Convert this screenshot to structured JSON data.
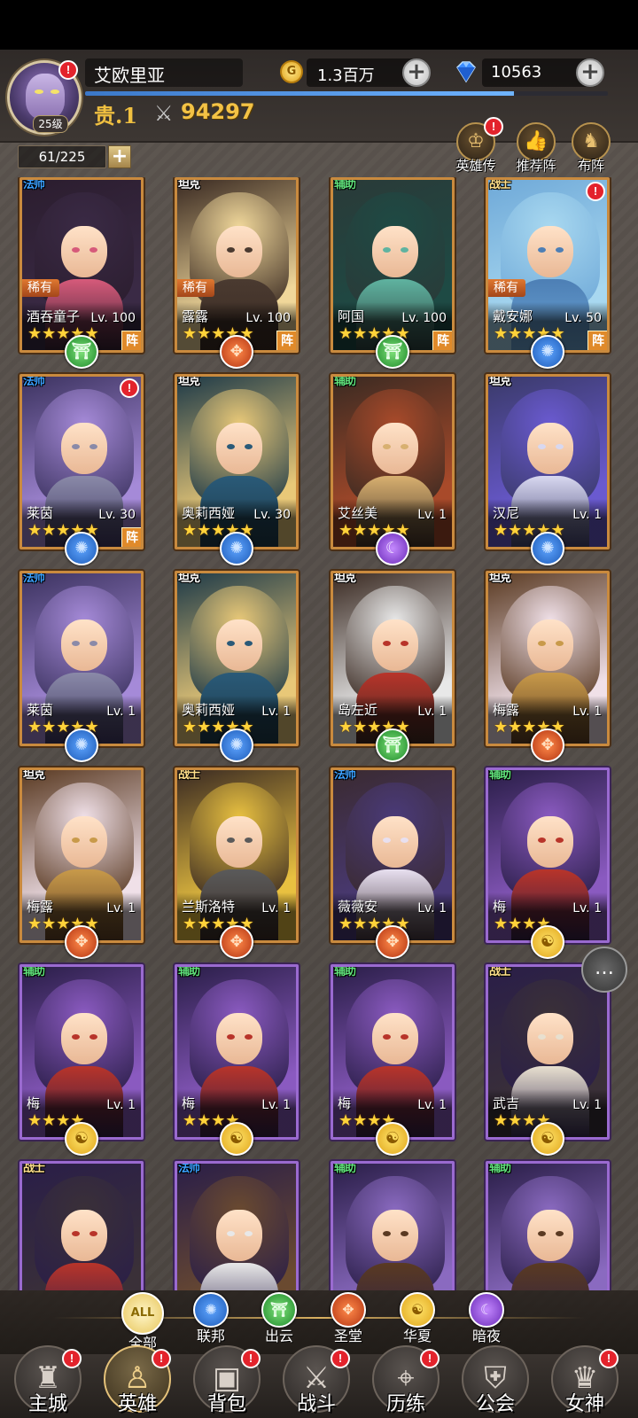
{
  "player": {
    "name": "艾欧里亚",
    "level_label": "25级",
    "vip_label": "贵.1",
    "power": "94297",
    "xp_progress": 0.82
  },
  "currency": {
    "gold": "1.3百万",
    "gold_icon": "G",
    "gems": "10563"
  },
  "hero_count": "61/225",
  "top_buttons": [
    {
      "label": "英雄传",
      "icon": "crown-icon",
      "alert": true
    },
    {
      "label": "推荐阵",
      "icon": "thumbs-up-icon",
      "alert": false
    },
    {
      "label": "布阵",
      "icon": "chess-knight-icon",
      "alert": false
    }
  ],
  "badge_text": "!",
  "rare_label": "稀有",
  "zhen_label": "阵",
  "heroes": [
    {
      "name": "酒吞童子",
      "level": "Lv. 100",
      "role": "法师",
      "stars": 5,
      "faction": "chuyun",
      "rare": true,
      "zhen": true,
      "alert": false,
      "frame": "gold",
      "palette": [
        "#2b1d2e",
        "#3a2a45",
        "#d65a7a"
      ]
    },
    {
      "name": "露露",
      "level": "Lv. 100",
      "role": "坦克",
      "stars": 5,
      "faction": "shengtang",
      "rare": true,
      "zhen": true,
      "alert": false,
      "frame": "gold",
      "palette": [
        "#3a2a22",
        "#f0d79a",
        "#4a3a30"
      ]
    },
    {
      "name": "阿国",
      "level": "Lv. 100",
      "role": "辅助",
      "stars": 5,
      "faction": "chuyun",
      "rare": false,
      "zhen": true,
      "alert": false,
      "frame": "gold",
      "palette": [
        "#2a3a38",
        "#1e4a44",
        "#5fb3a0"
      ]
    },
    {
      "name": "戴安娜",
      "level": "Lv. 50",
      "role": "战士",
      "stars": 5,
      "faction": "lianbang",
      "rare": true,
      "zhen": true,
      "alert": true,
      "frame": "gold",
      "palette": [
        "#6fa9d8",
        "#a8d8f0",
        "#4d7fb5"
      ]
    },
    {
      "name": "莱茵",
      "level": "Lv. 30",
      "role": "法师",
      "stars": 5,
      "faction": "lianbang",
      "rare": false,
      "zhen": true,
      "alert": true,
      "frame": "gold",
      "palette": [
        "#3c3360",
        "#a58ad8",
        "#8a8aa8"
      ]
    },
    {
      "name": "奥莉西娅",
      "level": "Lv. 30",
      "role": "坦克",
      "stars": 5,
      "faction": "lianbang",
      "rare": false,
      "zhen": false,
      "alert": false,
      "frame": "gold",
      "palette": [
        "#1e3a48",
        "#e8c878",
        "#2a5a78"
      ]
    },
    {
      "name": "艾丝美",
      "level": "Lv. 1",
      "role": "辅助",
      "stars": 5,
      "faction": "anye",
      "rare": false,
      "zhen": false,
      "alert": false,
      "frame": "gold",
      "palette": [
        "#3a2a22",
        "#a84a2a",
        "#d8b070"
      ]
    },
    {
      "name": "汉尼",
      "level": "Lv. 1",
      "role": "坦克",
      "stars": 5,
      "faction": "lianbang",
      "rare": false,
      "zhen": false,
      "alert": false,
      "frame": "gold",
      "palette": [
        "#3a3a6a",
        "#6a5ad0",
        "#d8d8f0"
      ]
    },
    {
      "name": "莱茵",
      "level": "Lv. 1",
      "role": "法师",
      "stars": 5,
      "faction": "lianbang",
      "rare": false,
      "zhen": false,
      "alert": false,
      "frame": "gold",
      "palette": [
        "#3c3360",
        "#a58ad8",
        "#8a8aa8"
      ]
    },
    {
      "name": "奥莉西娅",
      "level": "Lv. 1",
      "role": "坦克",
      "stars": 5,
      "faction": "lianbang",
      "rare": false,
      "zhen": false,
      "alert": false,
      "frame": "gold",
      "palette": [
        "#1e3a48",
        "#e8c878",
        "#2a5a78"
      ]
    },
    {
      "name": "岛左近",
      "level": "Lv. 1",
      "role": "坦克",
      "stars": 5,
      "faction": "chuyun",
      "rare": false,
      "zhen": false,
      "alert": false,
      "frame": "gold",
      "palette": [
        "#3a2a22",
        "#e8e8e8",
        "#b8342a"
      ]
    },
    {
      "name": "梅露",
      "level": "Lv. 1",
      "role": "坦克",
      "stars": 5,
      "faction": "shengtang",
      "rare": false,
      "zhen": false,
      "alert": false,
      "frame": "gold",
      "palette": [
        "#5a3a22",
        "#f0e0e8",
        "#c89a4a"
      ]
    },
    {
      "name": "梅露",
      "level": "Lv. 1",
      "role": "坦克",
      "stars": 5,
      "faction": "shengtang",
      "rare": false,
      "zhen": false,
      "alert": false,
      "frame": "gold",
      "palette": [
        "#5a3a22",
        "#f0e0e8",
        "#c89a4a"
      ]
    },
    {
      "name": "兰斯洛特",
      "level": "Lv. 1",
      "role": "战士",
      "stars": 5,
      "faction": "shengtang",
      "rare": false,
      "zhen": false,
      "alert": false,
      "frame": "gold",
      "palette": [
        "#3a2a22",
        "#e8c040",
        "#5a5a5a"
      ]
    },
    {
      "name": "薇薇安",
      "level": "Lv. 1",
      "role": "法师",
      "stars": 5,
      "faction": "shengtang",
      "rare": false,
      "zhen": false,
      "alert": false,
      "frame": "gold",
      "palette": [
        "#3a2a30",
        "#4a3a78",
        "#e8e0f0"
      ]
    },
    {
      "name": "梅",
      "level": "Lv. 1",
      "role": "辅助",
      "stars": 4,
      "faction": "huaxia",
      "rare": false,
      "zhen": false,
      "alert": false,
      "frame": "purple",
      "palette": [
        "#2a1e48",
        "#8a5ac0",
        "#b8342a"
      ]
    },
    {
      "name": "梅",
      "level": "Lv. 1",
      "role": "辅助",
      "stars": 4,
      "faction": "huaxia",
      "rare": false,
      "zhen": false,
      "alert": false,
      "frame": "purple",
      "palette": [
        "#2a1e48",
        "#8a5ac0",
        "#b8342a"
      ]
    },
    {
      "name": "梅",
      "level": "Lv. 1",
      "role": "辅助",
      "stars": 4,
      "faction": "huaxia",
      "rare": false,
      "zhen": false,
      "alert": false,
      "frame": "purple",
      "palette": [
        "#2a1e48",
        "#8a5ac0",
        "#b8342a"
      ]
    },
    {
      "name": "梅",
      "level": "Lv. 1",
      "role": "辅助",
      "stars": 4,
      "faction": "huaxia",
      "rare": false,
      "zhen": false,
      "alert": false,
      "frame": "purple",
      "palette": [
        "#2a1e48",
        "#8a5ac0",
        "#b8342a"
      ]
    },
    {
      "name": "武吉",
      "level": "Lv. 1",
      "role": "战士",
      "stars": 4,
      "faction": "huaxia",
      "rare": false,
      "zhen": false,
      "alert": false,
      "frame": "purple",
      "palette": [
        "#2a1e48",
        "#3a3038",
        "#e8e0d0"
      ]
    },
    {
      "name": "",
      "level": "",
      "role": "战士",
      "stars": 0,
      "faction": "",
      "rare": false,
      "zhen": false,
      "alert": false,
      "frame": "purple",
      "palette": [
        "#2a1e48",
        "#3a3038",
        "#b8342a"
      ]
    },
    {
      "name": "",
      "level": "",
      "role": "法师",
      "stars": 0,
      "faction": "",
      "rare": false,
      "zhen": false,
      "alert": false,
      "frame": "purple",
      "palette": [
        "#2a1e48",
        "#6a4a30",
        "#e8e8e8"
      ]
    },
    {
      "name": "",
      "level": "",
      "role": "辅助",
      "stars": 0,
      "faction": "",
      "rare": false,
      "zhen": false,
      "alert": false,
      "frame": "purple",
      "palette": [
        "#2a1e48",
        "#8a6ac0",
        "#5a3a22"
      ]
    },
    {
      "name": "",
      "level": "",
      "role": "辅助",
      "stars": 0,
      "faction": "",
      "rare": false,
      "zhen": false,
      "alert": false,
      "frame": "purple",
      "palette": [
        "#2a1e48",
        "#8a6ac0",
        "#5a3a22"
      ]
    }
  ],
  "faction_symbols": {
    "lianbang": "✺",
    "chuyun": "⛩",
    "shengtang": "✥",
    "huaxia": "☯",
    "anye": "☾",
    "all": "ALL"
  },
  "role_colors": {
    "法师": "#3aa0ff",
    "坦克": "#ffffff",
    "辅助": "#5fe07a",
    "战士": "#ffe08a"
  },
  "filters": [
    {
      "key": "all",
      "label": "全部",
      "active": true
    },
    {
      "key": "lianbang",
      "label": "联邦",
      "active": false
    },
    {
      "key": "chuyun",
      "label": "出云",
      "active": false
    },
    {
      "key": "shengtang",
      "label": "圣堂",
      "active": false
    },
    {
      "key": "huaxia",
      "label": "华夏",
      "active": false
    },
    {
      "key": "anye",
      "label": "暗夜",
      "active": false
    }
  ],
  "nav": [
    {
      "label": "主城",
      "icon": "castle-icon",
      "glyph": "♜",
      "alert": true,
      "active": false
    },
    {
      "label": "英雄",
      "icon": "hero-hood-icon",
      "glyph": "♙",
      "alert": true,
      "active": true
    },
    {
      "label": "背包",
      "icon": "backpack-icon",
      "glyph": "▣",
      "alert": true,
      "active": false
    },
    {
      "label": "战斗",
      "icon": "crossed-swords-icon",
      "glyph": "⚔",
      "alert": true,
      "active": false
    },
    {
      "label": "历练",
      "icon": "map-icon",
      "glyph": "⌖",
      "alert": true,
      "active": false
    },
    {
      "label": "公会",
      "icon": "shield-icon",
      "glyph": "⛨",
      "alert": false,
      "active": false
    },
    {
      "label": "女神",
      "icon": "goddess-icon",
      "glyph": "♛",
      "alert": true,
      "active": false
    }
  ],
  "chat_icon": "…"
}
